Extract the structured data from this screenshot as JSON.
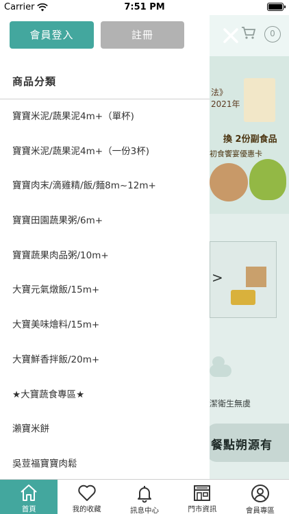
{
  "status_bar": {
    "carrier": "Carrier",
    "time": "7:51 PM"
  },
  "background": {
    "cart_count": "0",
    "banner_text_1": "法》",
    "banner_text_2": "2021年",
    "banner_text_3": "換 2份副食品",
    "banner_text_4": "初食饗宴優惠卡",
    "hygiene_text": "潔衛生無虞",
    "origin_text": "餐點朔源有"
  },
  "drawer": {
    "login_label": "會員登入",
    "register_label": "註冊",
    "section_title": "商品分類",
    "categories": [
      "寶寶米泥/蔬果泥4m+（單杯)",
      "寶寶米泥/蔬果泥4m+（一份3杯)",
      "寶寶肉末/滴雞精/飯/麵8m~12m+",
      "寶寶田園蔬果粥/6m+",
      "寶寶蔬果肉品粥/10m+",
      "大寶元氣燉飯/15m+",
      "大寶美味燴料/15m+",
      "大寶鮮香拌飯/20m+",
      "★大寶蔬食專區★",
      "瀨寶米餅",
      "吳荳福寶寶肉鬆"
    ]
  },
  "tabbar": {
    "tabs": [
      {
        "label": "首頁",
        "icon": "home-icon",
        "active": true
      },
      {
        "label": "我的收藏",
        "icon": "heart-icon",
        "active": false
      },
      {
        "label": "訊息中心",
        "icon": "bell-icon",
        "active": false
      },
      {
        "label": "門市資訊",
        "icon": "store-icon",
        "active": false
      },
      {
        "label": "會員專區",
        "icon": "user-icon",
        "active": false
      }
    ]
  },
  "colors": {
    "accent": "#43a79e",
    "register": "#b2b2b2"
  }
}
